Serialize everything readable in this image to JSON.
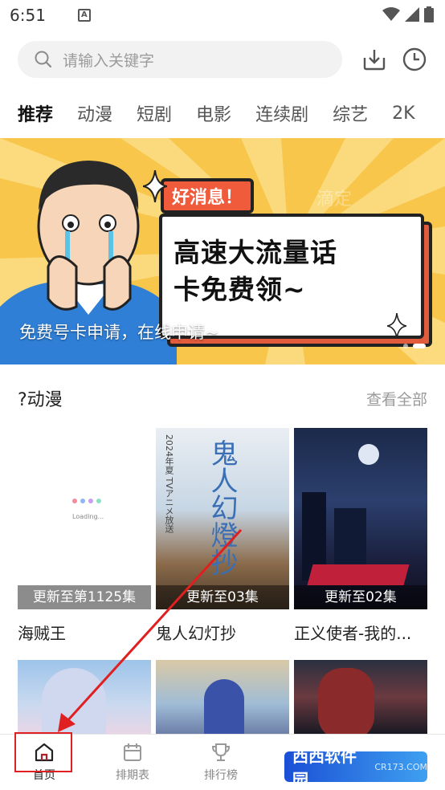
{
  "status": {
    "time": "6:51",
    "notif_letter": "A"
  },
  "search": {
    "placeholder": "请输入关键字"
  },
  "tabs": [
    {
      "label": "推荐"
    },
    {
      "label": "动漫"
    },
    {
      "label": "短剧"
    },
    {
      "label": "电影"
    },
    {
      "label": "连续剧"
    },
    {
      "label": "综艺"
    },
    {
      "label": "2K"
    }
  ],
  "banner": {
    "tag": "好消息！",
    "headline_line1": "高速大流量话",
    "headline_line2": "卡免费领~",
    "caption": "免费号卡申请，在线申请~",
    "watermark": "滴定"
  },
  "section": {
    "title": "?动漫",
    "more": "查看全部"
  },
  "items": [
    {
      "title": "海贼王",
      "badge": "更新至第1125集",
      "loading": "Loading..."
    },
    {
      "title": "鬼人幻灯抄",
      "badge": "更新至03集",
      "poster_text": "鬼人幻燈抄",
      "poster_side": "2024年夏 TVアニメ放送"
    },
    {
      "title": "正义使者-我的...",
      "badge": "更新至02集"
    }
  ],
  "nav": [
    {
      "label": "首页",
      "icon": "home-icon"
    },
    {
      "label": "排期表",
      "icon": "calendar-icon"
    },
    {
      "label": "排行榜",
      "icon": "trophy-icon"
    }
  ],
  "watermark_logo": {
    "text": "西西软件园",
    "sub": "CR173.COM"
  },
  "colors": {
    "accent": "#b31f2a",
    "banner": "#f7c64b"
  }
}
